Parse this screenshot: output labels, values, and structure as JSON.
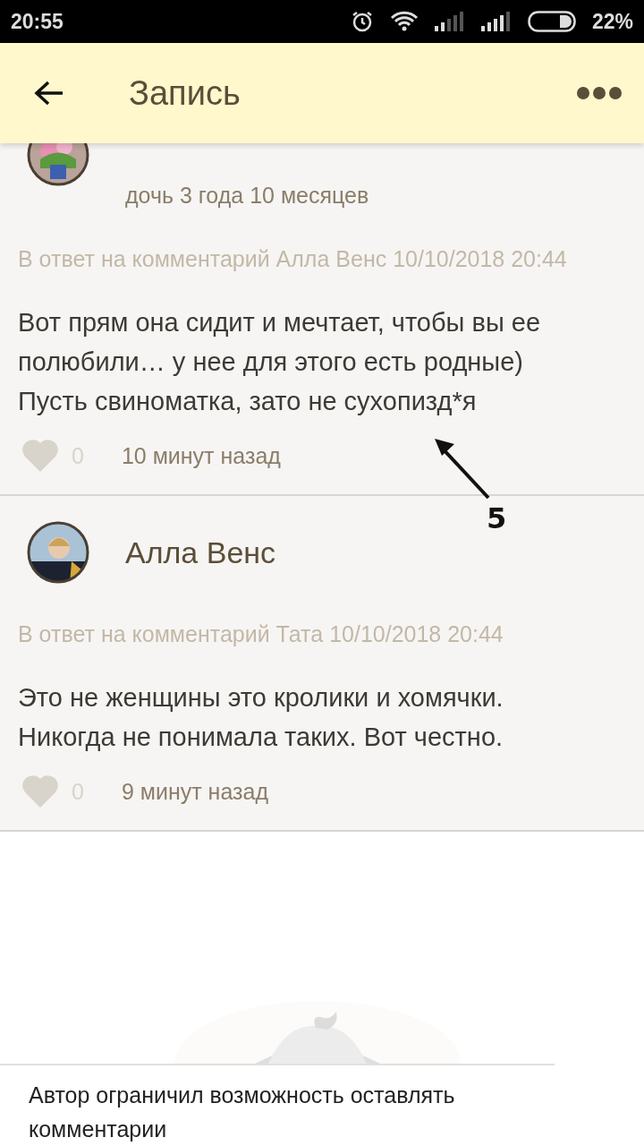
{
  "status_bar": {
    "time": "20:55",
    "battery": "22%"
  },
  "header": {
    "title": "Запись"
  },
  "comments": [
    {
      "kind": "cut",
      "subtitle": "дочь 3 года 10 месяцев",
      "reply_to": "В ответ на комментарий Алла Венс 10/10/2018 20:44",
      "text": "Вот прям она сидит и мечтает, чтобы вы ее полюбили… у нее для этого есть родные) Пусть свиноматка, зато не сухопизд*я",
      "liked": false,
      "likes": "0",
      "time": "10 минут назад"
    },
    {
      "kind": "full",
      "author": "Алла Венс",
      "reply_to": "В ответ на комментарий Тата  10/10/2018 20:44",
      "text": "Это не женщины это кролики и хомячки. Никогда не понимала таких. Вот честно.",
      "liked": false,
      "likes": "0",
      "time": "9 минут назад"
    }
  ],
  "annotation": {
    "label": "5"
  },
  "footer": {
    "notice": "Автор ограничил возможность оставлять комментарии"
  }
}
